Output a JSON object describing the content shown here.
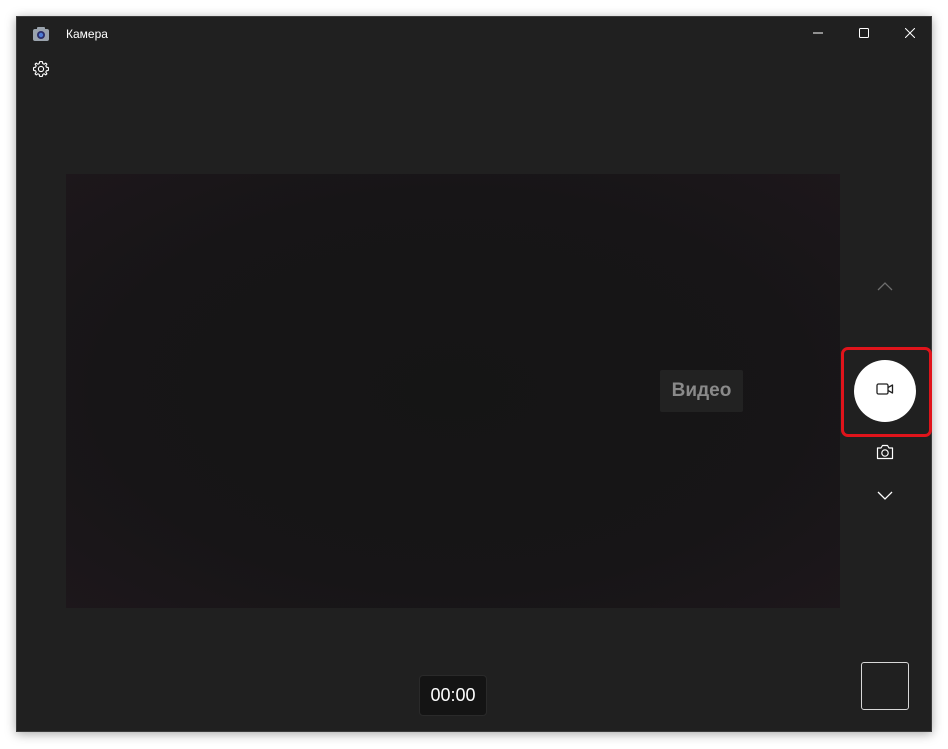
{
  "window": {
    "title": "Камера"
  },
  "icons": {
    "app": "camera-app-icon",
    "minimize": "minimize-icon",
    "maximize": "maximize-icon",
    "close": "close-icon",
    "settings": "gear-icon",
    "mode_up": "chevron-up-icon",
    "mode_down": "chevron-down-icon",
    "record": "video-camera-icon",
    "photo": "camera-icon"
  },
  "camera": {
    "mode_label": "Видео",
    "timer": "00:00"
  },
  "colors": {
    "background": "#202020",
    "highlight": "#e0141b",
    "record_button": "#ffffff"
  }
}
